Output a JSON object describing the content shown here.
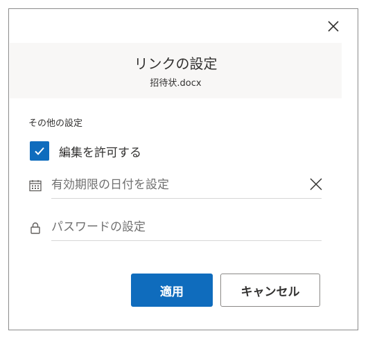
{
  "dialog": {
    "title": "リンクの設定",
    "subtitle": "招待状.docx",
    "close_icon": "close-icon"
  },
  "settings": {
    "section_label": "その他の設定",
    "allow_edit": {
      "label": "編集を許可する",
      "checked": true
    },
    "expiration": {
      "placeholder": "有効期限の日付を設定",
      "icon": "calendar-icon",
      "clear_icon": "close-icon"
    },
    "password": {
      "placeholder": "パスワードの設定",
      "icon": "lock-icon"
    }
  },
  "buttons": {
    "apply_label": "適用",
    "cancel_label": "キャンセル"
  },
  "colors": {
    "accent": "#0f6cbd",
    "header_bg": "#f8f7f6",
    "text": "#323130",
    "placeholder": "#707070",
    "underline": "#d6d6d6"
  }
}
